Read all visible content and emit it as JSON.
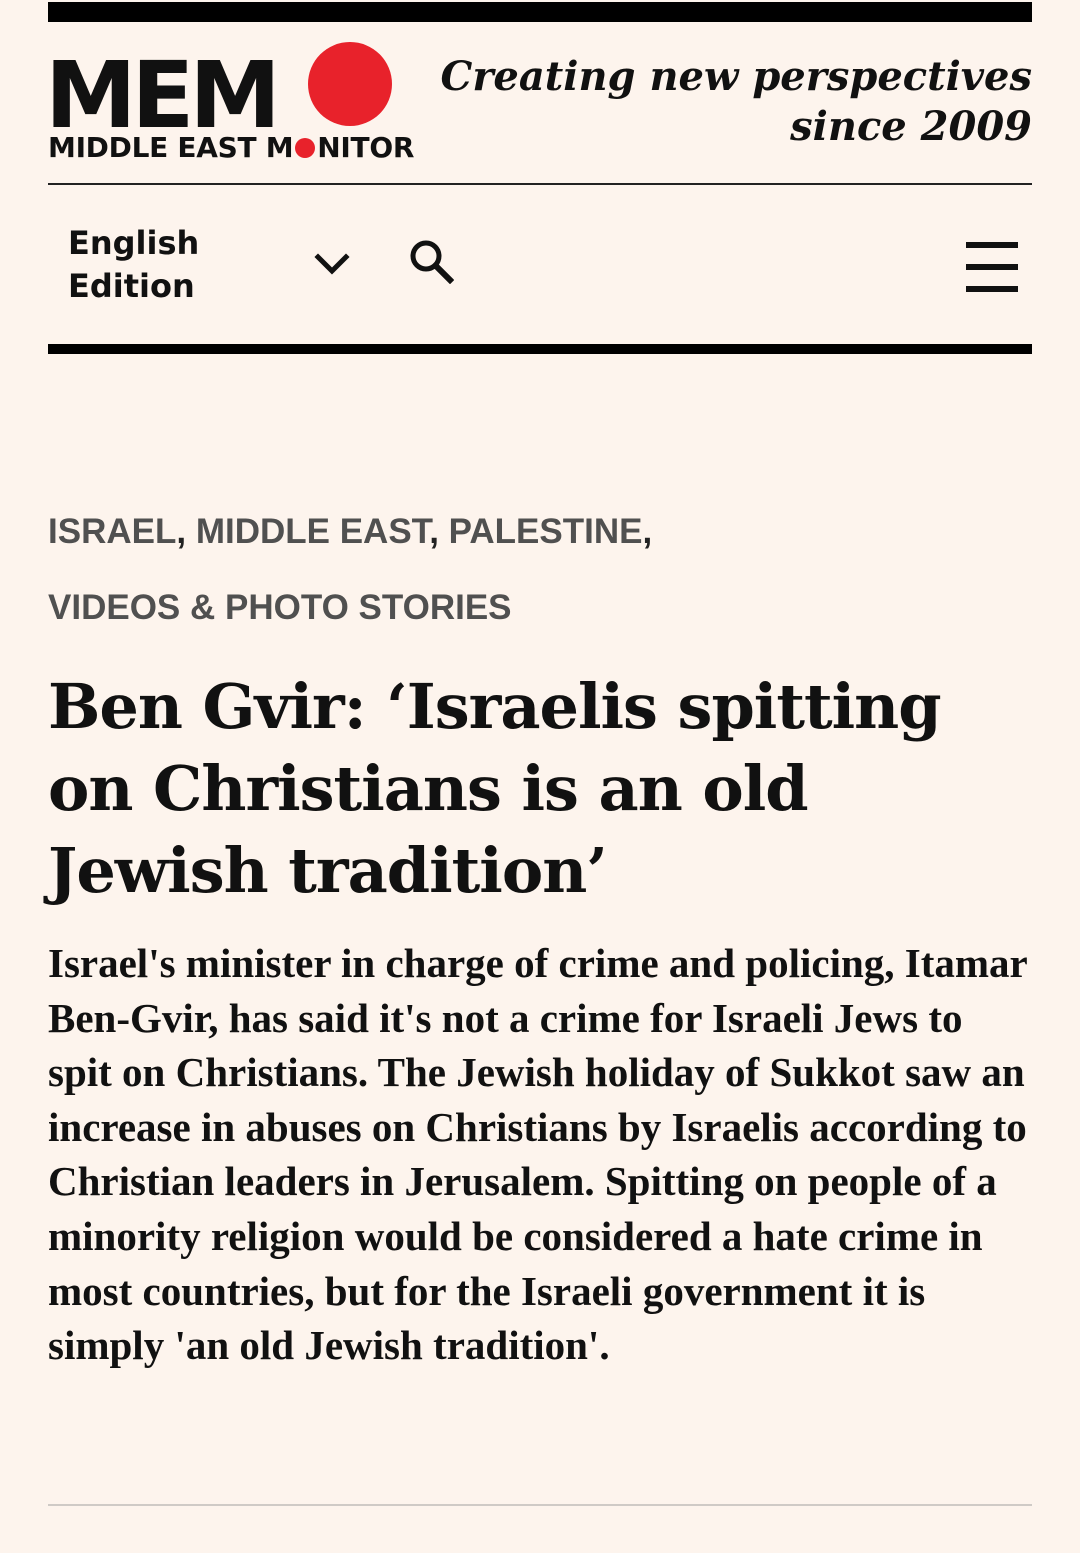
{
  "header": {
    "logo_text": "MEM",
    "logo_subtitle_before": "MIDDLE EAST M",
    "logo_subtitle_after": "NITOR",
    "tagline_line1": "Creating new perspectives",
    "tagline_line2": "since 2009"
  },
  "nav": {
    "edition_line1": "English",
    "edition_line2": "Edition",
    "icons": {
      "edition_toggle": "chevron-down-icon",
      "search": "search-icon",
      "menu": "hamburger-menu-icon"
    }
  },
  "article": {
    "categories": [
      "ISRAEL",
      "MIDDLE EAST",
      "PALESTINE",
      "VIDEOS & PHOTO STORIES"
    ],
    "title": "Ben Gvir: ‘Israelis spitting on Christians is an old Jewish tradition’",
    "summary": "Israel's minister in charge of crime and policing, Itamar Ben-Gvir, has said it's not a crime for Israeli Jews to spit on Christians. The Jewish holiday of Sukkot saw an increase in abuses on Christians by Israelis according to Christian leaders in Jerusalem. Spitting on people of a minority religion would be considered a hate crime in most countries, but for the Israeli government it is simply 'an old Jewish tradition'."
  },
  "colors": {
    "background": "#fdf4ed",
    "brand_red": "#e8222b",
    "text": "#111111",
    "category_gray": "#505050"
  }
}
